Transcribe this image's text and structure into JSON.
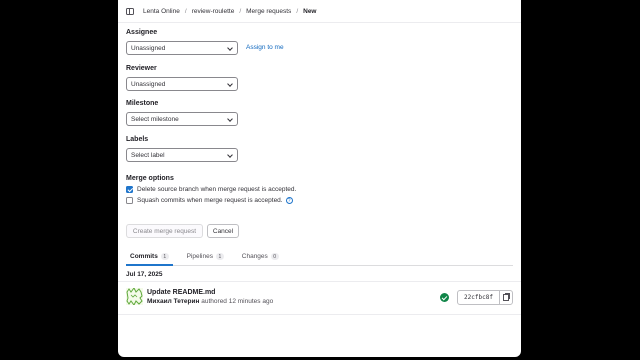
{
  "breadcrumb": [
    "Lenta Online",
    "review-roulette",
    "Merge requests",
    "New"
  ],
  "assignee": {
    "label": "Assignee",
    "value": "Unassigned",
    "assign_to_me": "Assign to me"
  },
  "reviewer": {
    "label": "Reviewer",
    "value": "Unassigned"
  },
  "milestone": {
    "label": "Milestone",
    "value": "Select milestone"
  },
  "labels": {
    "label": "Labels",
    "value": "Select label"
  },
  "merge_options": {
    "label": "Merge options",
    "delete_branch": {
      "text": "Delete source branch when merge request is accepted.",
      "checked": true
    },
    "squash": {
      "text": "Squash commits when merge request is accepted.",
      "checked": false
    }
  },
  "buttons": {
    "create": "Create merge request",
    "cancel": "Cancel"
  },
  "tabs": [
    {
      "label": "Commits",
      "count": "1",
      "active": true
    },
    {
      "label": "Pipelines",
      "count": "1",
      "active": false
    },
    {
      "label": "Changes",
      "count": "0",
      "active": false
    }
  ],
  "commits": {
    "date": "Jul 17, 2025",
    "title": "Update README.md",
    "author": "Михаил Тетерин",
    "meta": "authored 12 minutes ago",
    "sha": "22cfbc8f",
    "pipeline_status": "passed",
    "status_color": "#108548"
  },
  "colors": {
    "accent": "#1f75cb",
    "link": "#1068bf"
  }
}
